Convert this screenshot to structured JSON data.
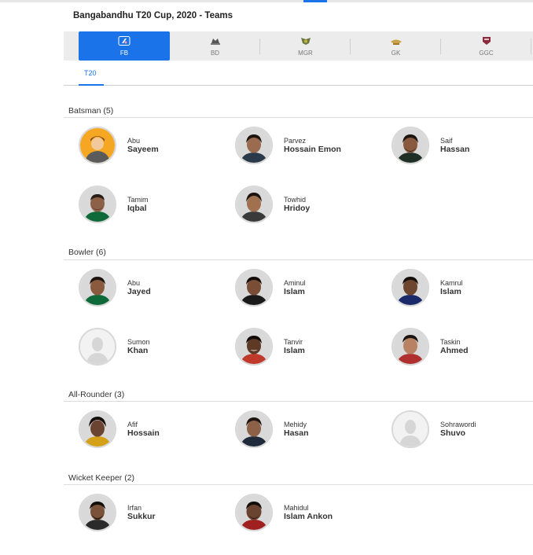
{
  "page_title": "Bangabandhu T20 Cup, 2020 - Teams",
  "team_tabs": [
    {
      "label": "FB",
      "logo": "fortune-barishal-logo-icon",
      "active": true
    },
    {
      "label": "BD",
      "logo": "beximco-dhaka-logo-icon",
      "active": false
    },
    {
      "label": "MGR",
      "logo": "minister-group-rajshahi-logo-icon",
      "active": false
    },
    {
      "label": "GK",
      "logo": "gemcon-khulna-logo-icon",
      "active": false
    },
    {
      "label": "GGC",
      "logo": "gazi-group-chattogram-logo-icon",
      "active": false
    }
  ],
  "format_tab": "T20",
  "colors": {
    "accent": "#1a73e8"
  },
  "sections": [
    {
      "title": "Batsman (5)",
      "players": [
        {
          "first": "Abu",
          "last": "Sayeem",
          "avatar": "placeholder-illustration"
        },
        {
          "first": "Parvez",
          "last": "Hossain Emon",
          "avatar": "photo"
        },
        {
          "first": "Saif",
          "last": "Hassan",
          "avatar": "photo"
        },
        {
          "first": "Tamim",
          "last": "Iqbal",
          "avatar": "photo"
        },
        {
          "first": "Towhid",
          "last": "Hridoy",
          "avatar": "photo"
        }
      ]
    },
    {
      "title": "Bowler (6)",
      "players": [
        {
          "first": "Abu",
          "last": "Jayed",
          "avatar": "photo"
        },
        {
          "first": "Aminul",
          "last": "Islam",
          "avatar": "photo"
        },
        {
          "first": "Kamrul",
          "last": "Islam",
          "avatar": "photo"
        },
        {
          "first": "Sumon",
          "last": "Khan",
          "avatar": "default-silhouette"
        },
        {
          "first": "Tanvir",
          "last": "Islam",
          "avatar": "photo"
        },
        {
          "first": "Taskin",
          "last": "Ahmed",
          "avatar": "photo"
        }
      ]
    },
    {
      "title": "All-Rounder (3)",
      "players": [
        {
          "first": "Afif",
          "last": "Hossain",
          "avatar": "photo"
        },
        {
          "first": "Mehidy",
          "last": "Hasan",
          "avatar": "photo"
        },
        {
          "first": "Sohrawordi",
          "last": "Shuvo",
          "avatar": "default-silhouette"
        }
      ]
    },
    {
      "title": "Wicket Keeper (2)",
      "players": [
        {
          "first": "Irfan",
          "last": "Sukkur",
          "avatar": "photo"
        },
        {
          "first": "Mahidul",
          "last": "Islam Ankon",
          "avatar": "photo"
        }
      ]
    }
  ]
}
